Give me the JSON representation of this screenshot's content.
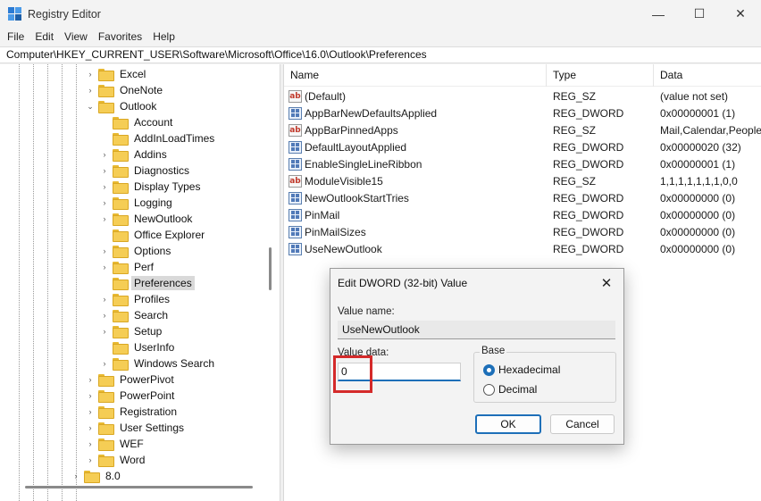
{
  "window": {
    "title": "Registry Editor",
    "minimize_glyph": "—",
    "maximize_glyph": "☐",
    "close_glyph": "✕"
  },
  "menu": [
    "File",
    "Edit",
    "View",
    "Favorites",
    "Help"
  ],
  "address": "Computer\\HKEY_CURRENT_USER\\Software\\Microsoft\\Office\\16.0\\Outlook\\Preferences",
  "tree": [
    {
      "label": "Excel",
      "expander": "›"
    },
    {
      "label": "OneNote",
      "expander": "›"
    },
    {
      "label": "Outlook",
      "expander": "⌄"
    },
    {
      "label": "Account",
      "expander": ""
    },
    {
      "label": "AddInLoadTimes",
      "expander": ""
    },
    {
      "label": "Addins",
      "expander": "›"
    },
    {
      "label": "Diagnostics",
      "expander": "›"
    },
    {
      "label": "Display Types",
      "expander": "›"
    },
    {
      "label": "Logging",
      "expander": "›"
    },
    {
      "label": "NewOutlook",
      "expander": "›"
    },
    {
      "label": "Office Explorer",
      "expander": ""
    },
    {
      "label": "Options",
      "expander": "›"
    },
    {
      "label": "Perf",
      "expander": "›"
    },
    {
      "label": "Preferences",
      "expander": ""
    },
    {
      "label": "Profiles",
      "expander": "›"
    },
    {
      "label": "Search",
      "expander": "›"
    },
    {
      "label": "Setup",
      "expander": "›"
    },
    {
      "label": "UserInfo",
      "expander": ""
    },
    {
      "label": "Windows Search",
      "expander": "›"
    },
    {
      "label": "PowerPivot",
      "expander": "›"
    },
    {
      "label": "PowerPoint",
      "expander": "›"
    },
    {
      "label": "Registration",
      "expander": "›"
    },
    {
      "label": "User Settings",
      "expander": "›"
    },
    {
      "label": "WEF",
      "expander": "›"
    },
    {
      "label": "Word",
      "expander": "›"
    },
    {
      "label": "8.0",
      "expander": "›"
    }
  ],
  "list": {
    "columns": [
      "Name",
      "Type",
      "Data"
    ],
    "rows": [
      {
        "icon": "ab",
        "name": "(Default)",
        "type": "REG_SZ",
        "data": "(value not set)"
      },
      {
        "icon": "dword",
        "name": "AppBarNewDefaultsApplied",
        "type": "REG_DWORD",
        "data": "0x00000001 (1)"
      },
      {
        "icon": "ab",
        "name": "AppBarPinnedApps",
        "type": "REG_SZ",
        "data": "Mail,Calendar,People"
      },
      {
        "icon": "dword",
        "name": "DefaultLayoutApplied",
        "type": "REG_DWORD",
        "data": "0x00000020 (32)"
      },
      {
        "icon": "dword",
        "name": "EnableSingleLineRibbon",
        "type": "REG_DWORD",
        "data": "0x00000001 (1)"
      },
      {
        "icon": "ab",
        "name": "ModuleVisible15",
        "type": "REG_SZ",
        "data": "1,1,1,1,1,1,1,0,0"
      },
      {
        "icon": "dword",
        "name": "NewOutlookStartTries",
        "type": "REG_DWORD",
        "data": "0x00000000 (0)"
      },
      {
        "icon": "dword",
        "name": "PinMail",
        "type": "REG_DWORD",
        "data": "0x00000000 (0)"
      },
      {
        "icon": "dword",
        "name": "PinMailSizes",
        "type": "REG_DWORD",
        "data": "0x00000000 (0)"
      },
      {
        "icon": "dword",
        "name": "UseNewOutlook",
        "type": "REG_DWORD",
        "data": "0x00000000 (0)"
      }
    ]
  },
  "dialog": {
    "title": "Edit DWORD (32-bit) Value",
    "close_glyph": "✕",
    "value_name_label": "Value name:",
    "value_name": "UseNewOutlook",
    "value_data_label": "Value data:",
    "value_data": "0",
    "base_label": "Base",
    "hex_label": "Hexadecimal",
    "dec_label": "Decimal",
    "selected_base": "Hexadecimal",
    "ok_label": "OK",
    "cancel_label": "Cancel"
  }
}
